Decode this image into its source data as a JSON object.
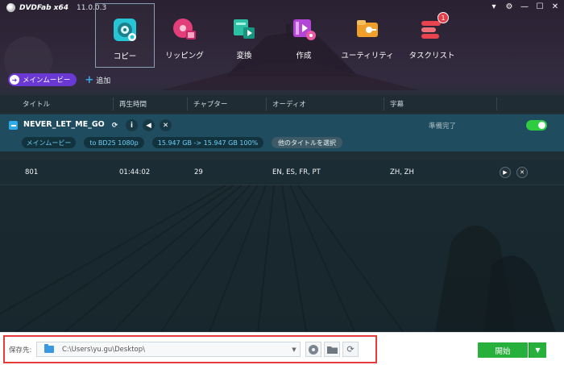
{
  "app": {
    "name": "DVDFab x64",
    "version": "11.0.0.3"
  },
  "window_controls": [
    "pin-icon",
    "gear-icon",
    "minimize-icon",
    "maximize-icon",
    "close-icon"
  ],
  "nav": [
    {
      "label": "コピー",
      "icon": "copy-disc-icon",
      "active": true
    },
    {
      "label": "リッピング",
      "icon": "ripper-icon",
      "active": false
    },
    {
      "label": "変換",
      "icon": "converter-icon",
      "active": false
    },
    {
      "label": "作成",
      "icon": "creator-icon",
      "active": false
    },
    {
      "label": "ユーティリティ",
      "icon": "utility-icon",
      "active": false
    },
    {
      "label": "タスクリスト",
      "icon": "task-list-icon",
      "active": false,
      "badge": "1"
    }
  ],
  "source": {
    "mode_label": "メインムービー",
    "add_label": "追加"
  },
  "table": {
    "headers": [
      "タイトル",
      "再生時間",
      "チャプター",
      "オーディオ",
      "字幕"
    ]
  },
  "title_item": {
    "name": "NEVER_LET_ME_GO",
    "status": "準備完了",
    "enabled": true,
    "chips": {
      "mode": "メインムービー",
      "output": "to BD25 1080p",
      "size": "15.947 GB -> 15.947 GB 100%",
      "other_titles": "他のタイトルを選択"
    },
    "icons": [
      "refresh-icon",
      "info-icon",
      "audio-icon",
      "close-icon"
    ]
  },
  "track": {
    "title": "801",
    "duration": "01:44:02",
    "chapters": "29",
    "audio": "EN, ES, FR, PT",
    "subtitles": "ZH, ZH"
  },
  "bottom": {
    "save_label": "保存先:",
    "path": "C:\\Users\\yu.gu\\Desktop\\",
    "iso_label": "ISO",
    "start_label": "開始"
  },
  "colors": {
    "accent_blue": "#2fa9e8",
    "main_movie_purple": "#6a38d3",
    "start_green": "#27b03b",
    "highlight_red": "#e53b3b"
  }
}
